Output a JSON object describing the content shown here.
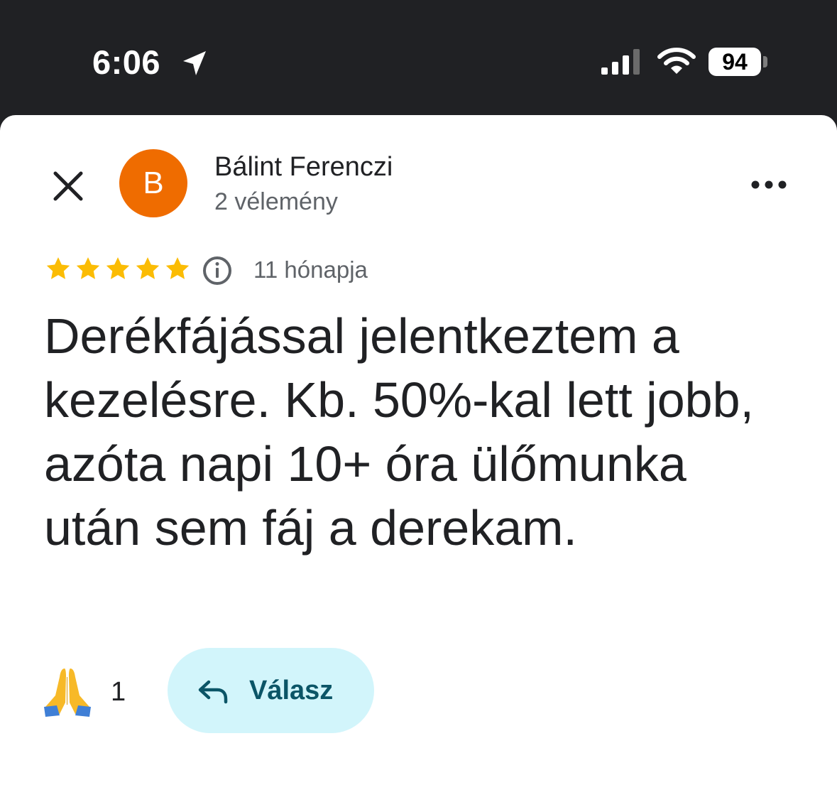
{
  "status_bar": {
    "time": "6:06",
    "battery_level": "94",
    "icons": [
      "location-icon",
      "signal-icon",
      "wifi-icon",
      "battery-icon"
    ]
  },
  "review": {
    "reviewer": {
      "name": "Bálint Ferenczi",
      "avatar_letter": "B",
      "review_count": "2 vélemény",
      "avatar_color": "#ef6c00"
    },
    "rating": 5,
    "max_rating": 5,
    "star_color": "#fbbc04",
    "time": "11 hónapja",
    "text": "Derékfájással jelentkeztem a kezelésre. Kb. 50%-kal lett jobb, azóta napi 10+ óra ülőmunka után sem fáj a derekam."
  },
  "actions": {
    "reaction_icon": "folded-hands-icon",
    "reaction_count": "1",
    "reply_label": "Válasz",
    "reply_button_color": "#d2f5fb",
    "reply_text_color": "#0b5567"
  },
  "toolbar_icons": [
    "close-icon",
    "more-icon",
    "info-icon",
    "reply-arrow-icon"
  ]
}
